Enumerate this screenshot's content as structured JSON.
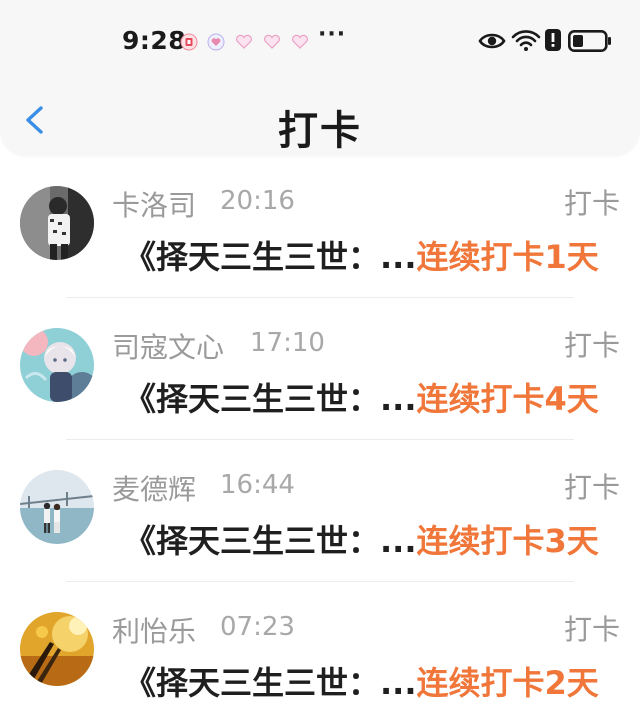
{
  "status_bar": {
    "time": "9:28",
    "more": "···",
    "notification_icons": [
      "app-notification-icon",
      "heart-icon",
      "heart-icon",
      "heart-icon",
      "heart-icon"
    ],
    "right_icons": [
      "eye-icon",
      "wifi-icon",
      "alert-icon",
      "battery-icon"
    ]
  },
  "header": {
    "title": "打卡",
    "back_icon": "chevron-left-icon",
    "accent_color": "#3a8ee6"
  },
  "list": {
    "items": [
      {
        "name": "卡洛司",
        "time": "20:16",
        "action": "打卡",
        "book": "《择天三生三世：...",
        "streak": "连续打卡1天"
      },
      {
        "name": "司寇文心",
        "time": "17:10",
        "action": "打卡",
        "book": "《择天三生三世：...",
        "streak": "连续打卡4天"
      },
      {
        "name": "麦德辉",
        "time": "16:44",
        "action": "打卡",
        "book": "《择天三生三世：...",
        "streak": "连续打卡3天"
      },
      {
        "name": "利怡乐",
        "time": "07:23",
        "action": "打卡",
        "book": "《择天三生三世：...",
        "streak": "连续打卡2天"
      }
    ]
  },
  "colors": {
    "streak": "#f0763a",
    "secondary_text": "#9a9a9a",
    "primary_text": "#1f1f1f"
  }
}
